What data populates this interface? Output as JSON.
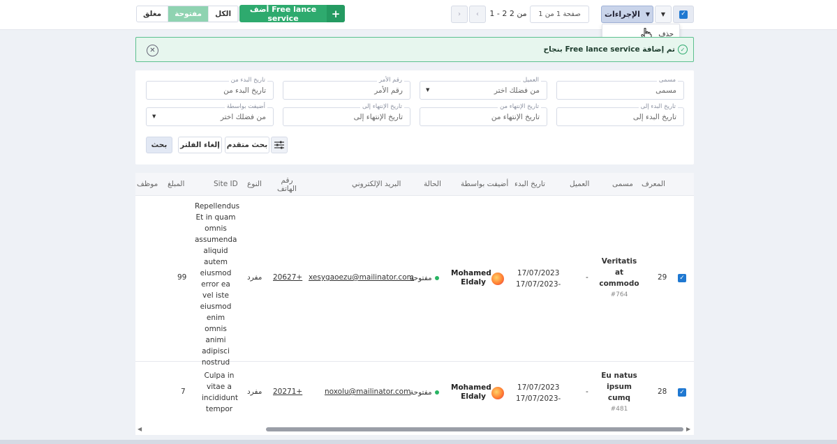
{
  "toolbar": {
    "actions_label": "الإجراءات",
    "delete_label": "حذف",
    "page_label": "صفحة 1 من 1",
    "range_label": "1 - 2 من 2",
    "prev_icon": "‹",
    "next_icon": "›",
    "add_label": "أضف Free lance service",
    "add_icon": "+",
    "tabs": [
      "الكل",
      "مفتوحة",
      "مغلق"
    ]
  },
  "alert": {
    "message": "تم إضافة Free lance service بنجاح"
  },
  "filters": {
    "row1": [
      {
        "label": "مسمى",
        "value": "مسمى",
        "dropdown": false
      },
      {
        "label": "العميل",
        "value": "من فضلك اختر",
        "dropdown": true
      },
      {
        "label": "رقم الأمر",
        "value": "رقم الأمر",
        "dropdown": false
      },
      {
        "label": "تاريخ البدء من",
        "value": "تاريخ البدء من",
        "dropdown": false
      }
    ],
    "row2": [
      {
        "label": "تاريخ البدء إلى",
        "value": "تاريخ البدء إلى",
        "dropdown": false
      },
      {
        "label": "تاريخ الإنتهاء من",
        "value": "تاريخ الإنتهاء من",
        "dropdown": false
      },
      {
        "label": "تاريخ الإنتهاء إلى",
        "value": "تاريخ الإنتهاء إلى",
        "dropdown": false
      },
      {
        "label": "أضيفت بواسطة",
        "value": "من فضلك اختر",
        "dropdown": true
      }
    ],
    "advanced_label": "بحث متقدم",
    "clear_label": "إلغاء الفلتر",
    "search_label": "بحث"
  },
  "table": {
    "headers": {
      "id": "المعرف",
      "title": "مسمى",
      "client": "العميل",
      "start_date": "تاريخ البدء",
      "added_by": "أضيفت بواسطة",
      "status": "الحالة",
      "email": "البريد الإلكتروني",
      "phone_line1": "رقم",
      "phone_line2": "الهاتف",
      "type": "النوع",
      "site_id": "Site ID",
      "amount": "المبلغ",
      "employee": "موظف"
    },
    "rows": [
      {
        "id": "29",
        "title": "Veritatis at commodo",
        "code": "#764",
        "client": "-",
        "start_date": "17/07/2023",
        "end_date": "17/07/2023-",
        "added_by_first": "Mohamed",
        "added_by_last": "Eldaly",
        "status": "مفتوحة",
        "email": "xesygaoezu@mailinator.com",
        "phone": "20627+",
        "type": "مفرد",
        "site_id": "Repellendus Et in quam omnis assumenda aliquid autem eiusmod error ea vel iste eiusmod enim omnis animi adipisci nostrud",
        "amount": "99"
      },
      {
        "id": "28",
        "title": "Eu natus ipsum cumq",
        "code": "#481",
        "client": "-",
        "start_date": "17/07/2023",
        "end_date": "17/07/2023-",
        "added_by_first": "Mohamed",
        "added_by_last": "Eldaly",
        "status": "مفتوحة",
        "email": "noxolu@mailinator.com",
        "phone": "20271+",
        "type": "مفرد",
        "site_id": "Culpa in vitae a incididunt tempor",
        "amount": "7"
      }
    ]
  },
  "colors": {
    "primary": "#1f78d1",
    "success": "#2eaa6e",
    "active_tab": "#8fd3b1"
  }
}
